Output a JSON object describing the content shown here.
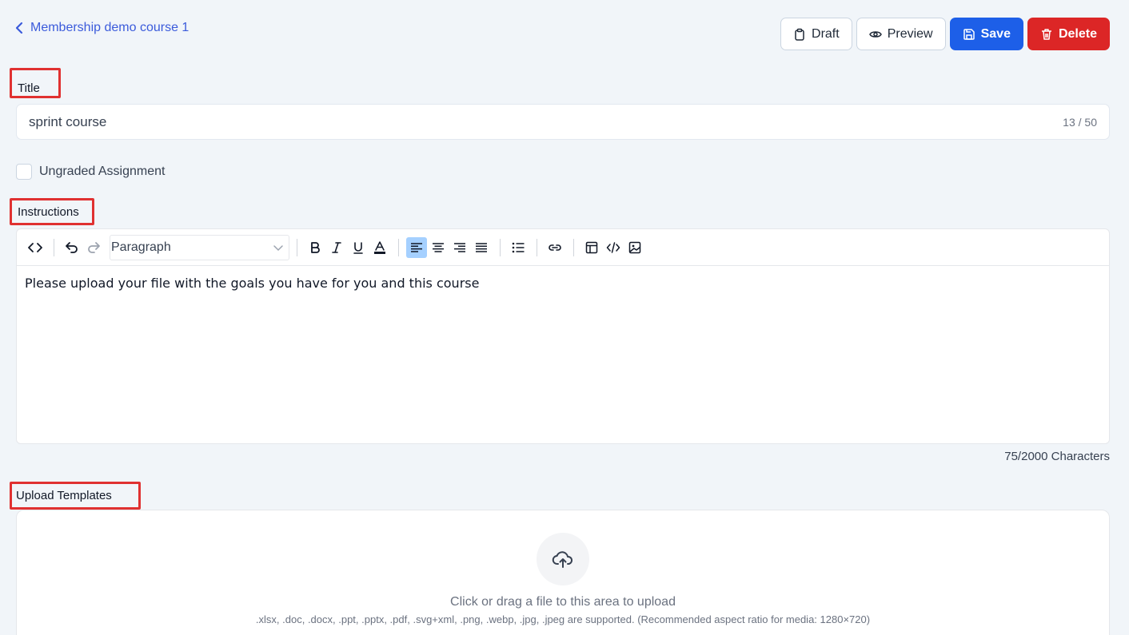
{
  "header": {
    "back_label": "Membership demo course 1",
    "buttons": {
      "draft": "Draft",
      "preview": "Preview",
      "save": "Save",
      "delete": "Delete"
    }
  },
  "title_field": {
    "label": "Title",
    "value": "sprint course",
    "counter": "13 / 50"
  },
  "ungraded": {
    "label": "Ungraded Assignment",
    "checked": false
  },
  "instructions": {
    "label": "Instructions",
    "block_format": "Paragraph",
    "content": "Please upload your file with the goals you have for you and this course",
    "char_count": "75/2000 Characters"
  },
  "upload": {
    "label": "Upload Templates",
    "prompt": "Click or drag a file to this area to upload",
    "hint": ".xlsx, .doc, .docx, .ppt, .pptx, .pdf, .svg+xml, .png, .webp, .jpg, .jpeg are supported. (Recommended aspect ratio for media: 1280×720)"
  },
  "colors": {
    "accent": "#1d5fe8",
    "danger": "#dc2626",
    "highlight": "#e03131",
    "link": "#3b5bdb"
  }
}
